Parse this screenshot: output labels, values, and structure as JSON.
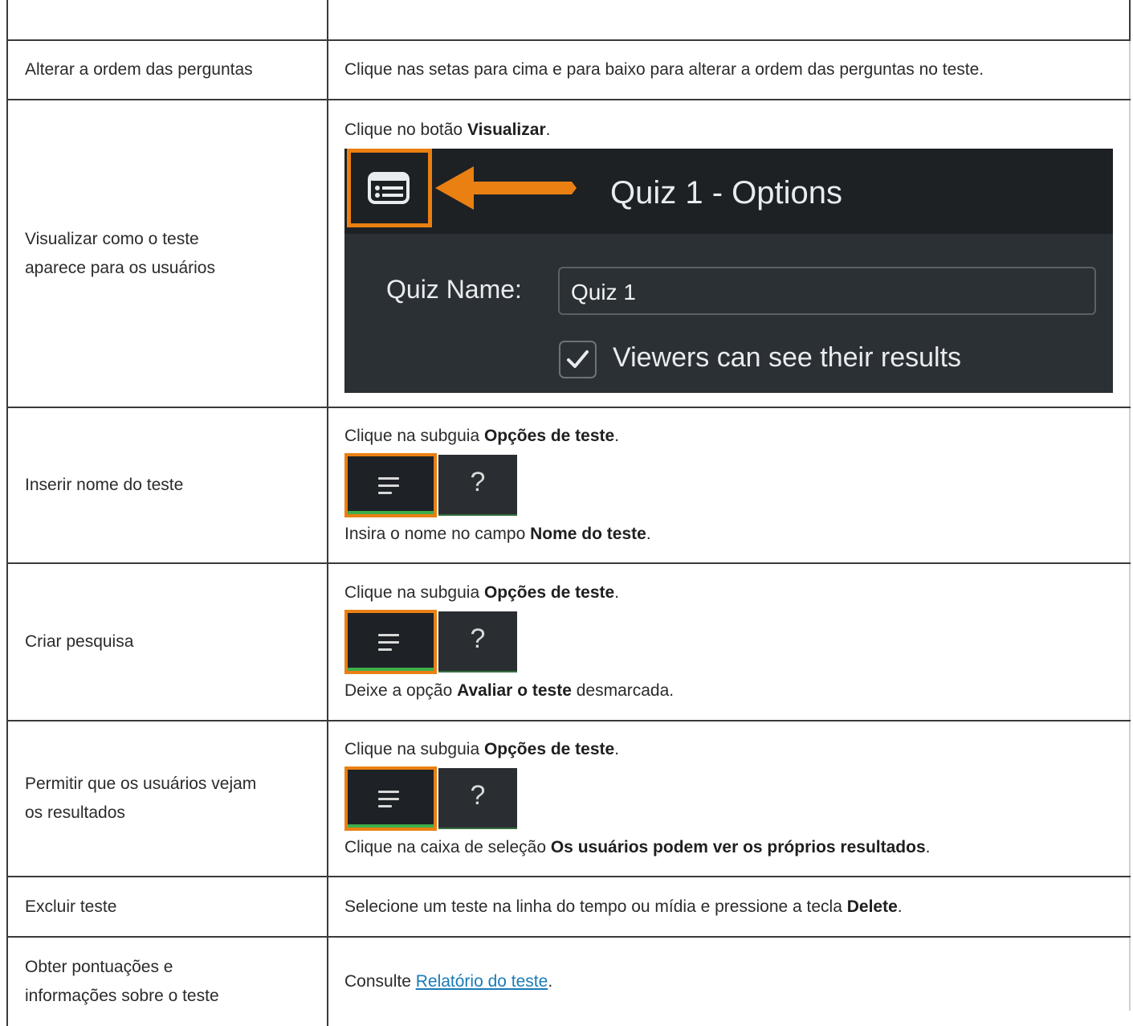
{
  "rows": [
    {
      "name": "Alterar a ordem das perguntas",
      "desc": "Clique nas setas para cima e para baixo para alterar a ordem das perguntas no teste."
    },
    {
      "name_l1": "Visualizar como o teste",
      "name_l2": "aparece para os usuários",
      "desc_pre": "Clique no botão ",
      "desc_bold": "Visualizar",
      "desc_post": ".",
      "preview": {
        "title": "Quiz 1 - Options",
        "quiz_name_label": "Quiz Name:",
        "quiz_name_value": "Quiz 1",
        "checkbox_label": "Viewers can see their results"
      }
    },
    {
      "name": "Inserir nome do teste",
      "l1_pre": "Clique na subguia ",
      "l1_bold": "Opções de teste",
      "l1_post": ".",
      "l2_pre": "Insira o nome no campo ",
      "l2_bold": "Nome do teste",
      "l2_post": "."
    },
    {
      "name": "Criar pesquisa",
      "l1_pre": "Clique na subguia ",
      "l1_bold": "Opções de teste",
      "l1_post": ".",
      "l2_pre": "Deixe a opção ",
      "l2_bold": "Avaliar o teste",
      "l2_post": " desmarcada."
    },
    {
      "name_l1": "Permitir que os usuários vejam",
      "name_l2": "os resultados",
      "l1_pre": "Clique na subguia ",
      "l1_bold": "Opções de teste",
      "l1_post": ".",
      "l2_pre": "Clique na caixa de seleção ",
      "l2_bold": "Os usuários podem ver os próprios resultados",
      "l2_post": "."
    },
    {
      "name": "Excluir teste",
      "desc_pre": "Selecione um teste na linha do tempo ou mídia e pressione a tecla ",
      "desc_bold": "Delete",
      "desc_post": "."
    },
    {
      "name_l1": "Obter pontuações e",
      "name_l2": "informações sobre o teste",
      "desc_pre": "Consulte ",
      "link": "Relatório do teste",
      "desc_post": "."
    }
  ],
  "tab_help_glyph": "?",
  "colors": {
    "highlight": "#ea7f12",
    "dark_bg": "#1d2124",
    "link": "#1a7bb8",
    "tab_underline": "#3fae49"
  },
  "icons": [
    "list-view-icon",
    "left-arrow-icon",
    "checkmark-icon",
    "menu-lines-icon",
    "help-question-icon"
  ]
}
